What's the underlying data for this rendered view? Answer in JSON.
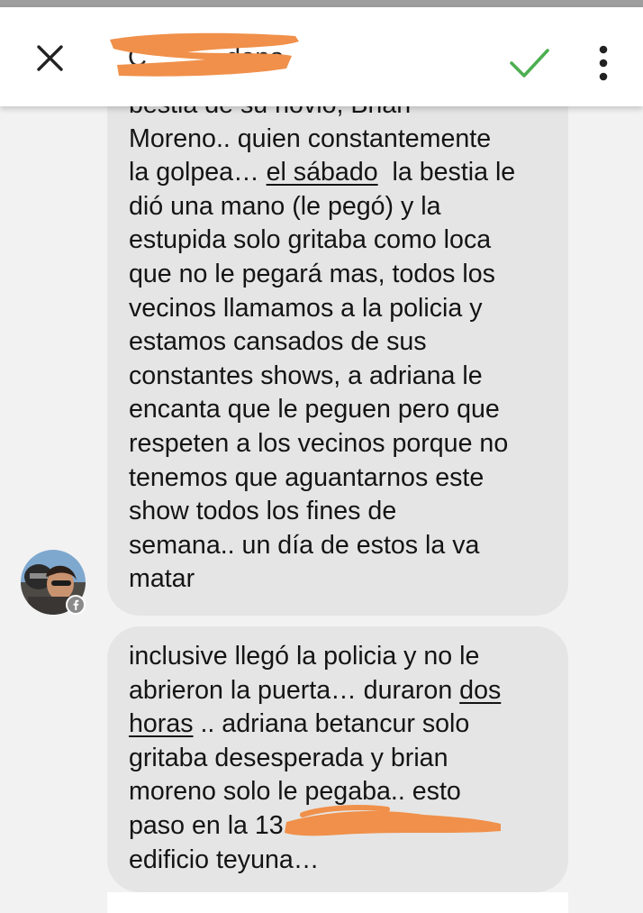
{
  "header": {
    "title_visible_fragment_start": "C",
    "title_visible_fragment_end": "dena",
    "close_icon": "close-icon",
    "confirm_icon": "check-icon",
    "menu_icon": "more-vertical-icon"
  },
  "messages": [
    {
      "lines": [
        "bestia de su novio, Brian",
        "Moreno.. quien constantemente",
        "la golpea… ",
        "el sábado",
        "  la bestia le",
        "dió una mano (le pegó) y la",
        "estupida solo gritaba como loca",
        "que no le pegará mas, todos los",
        "vecinos llamamos a la policia y",
        "estamos cansados de sus",
        "constantes shows, a adriana le",
        "encanta que le peguen pero que",
        "respeten a los vecinos porque no",
        "tenemos que aguantarnos este",
        "show todos los fines de",
        "semana.. un día de estos la va",
        "matar"
      ]
    },
    {
      "lines": [
        "inclusive llegó la policia y no le",
        "abrieron la puerta… duraron ",
        "dos",
        "horas",
        " .. adriana betancur solo",
        "gritaba desesperada y brian",
        "moreno solo le pegaba.. esto",
        "paso en la 13",
        "edificio teyuna…"
      ]
    }
  ],
  "avatar": {
    "badge_icon": "facebook-badge-icon"
  },
  "colors": {
    "accent_check": "#4caf50",
    "bubble": "#e5e5e5",
    "background": "#f2f2f2",
    "redaction": "#f0904a"
  }
}
